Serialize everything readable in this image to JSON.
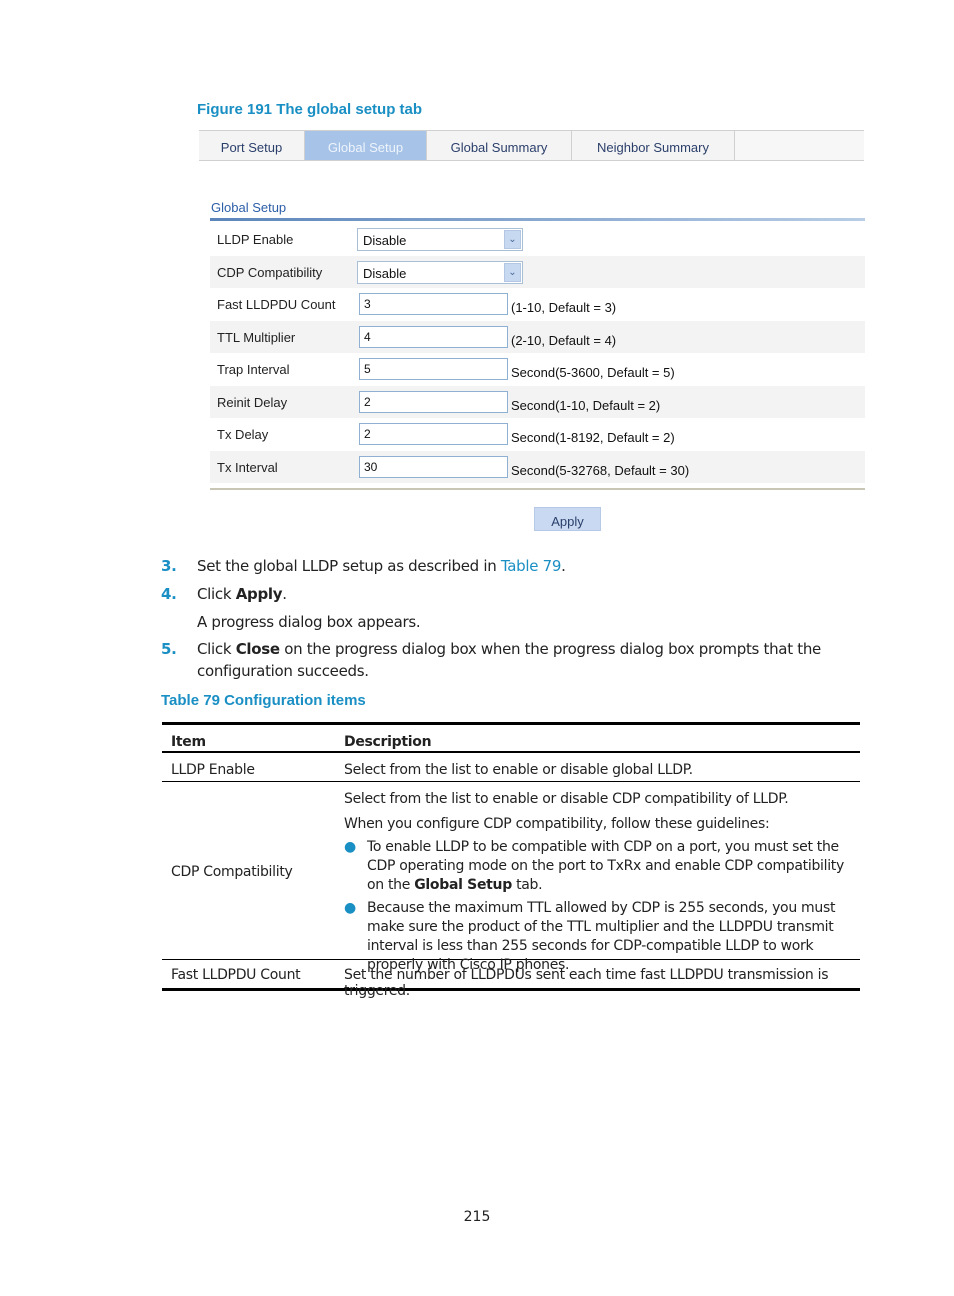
{
  "figure_caption": "Figure 191 The global setup tab",
  "tabs": [
    {
      "label": "Port Setup",
      "active": false
    },
    {
      "label": "Global Setup",
      "active": true
    },
    {
      "label": "Global Summary",
      "active": false
    },
    {
      "label": "Neighbor Summary",
      "active": false
    }
  ],
  "form": {
    "section_title": "Global Setup",
    "lldp_enable": {
      "label": "LLDP Enable",
      "value": "Disable"
    },
    "cdp_compatibility": {
      "label": "CDP Compatibility",
      "value": "Disable"
    },
    "fast_lldpdu_count": {
      "label": "Fast LLDPDU Count",
      "value": "3",
      "hint": "(1-10, Default = 3)"
    },
    "ttl_multiplier": {
      "label": "TTL Multiplier",
      "value": "4",
      "hint": "(2-10, Default = 4)"
    },
    "trap_interval": {
      "label": "Trap Interval",
      "value": "5",
      "hint": "Second(5-3600, Default = 5)"
    },
    "reinit_delay": {
      "label": "Reinit Delay",
      "value": "2",
      "hint": "Second(1-10, Default = 2)"
    },
    "tx_delay": {
      "label": "Tx Delay",
      "value": "2",
      "hint": "Second(1-8192, Default = 2)"
    },
    "tx_interval": {
      "label": "Tx Interval",
      "value": "30",
      "hint": "Second(5-32768, Default = 30)"
    },
    "apply_label": "Apply"
  },
  "steps": {
    "s3": {
      "num": "3.",
      "text_before": "Set the global LLDP setup as described in ",
      "link": "Table 79",
      "text_after": "."
    },
    "s4": {
      "num": "4.",
      "text_before": "Click ",
      "bold": "Apply",
      "text_after": ".",
      "note": "A progress dialog box appears."
    },
    "s5": {
      "num": "5.",
      "text_before": "Click ",
      "bold": "Close",
      "text_after": " on the progress dialog box when the progress dialog box prompts that the",
      "line2": "configuration succeeds."
    }
  },
  "table": {
    "caption": "Table 79 Configuration items",
    "headers": {
      "item": "Item",
      "description": "Description"
    },
    "rows": {
      "r1": {
        "item": "LLDP Enable",
        "desc": "Select from the list to enable or disable global LLDP."
      },
      "r2": {
        "item": "CDP Compatibility",
        "desc1": "Select from the list to enable or disable CDP compatibility of LLDP.",
        "desc2": "When you configure CDP compatibility, follow these guidelines:",
        "b1_text": "To enable LLDP to be compatible with CDP on a port, you must set the CDP operating mode on the port to TxRx and enable CDP compatibility on the ",
        "b1_bold": "Global Setup",
        "b1_after": " tab.",
        "b2_text": "Because the maximum TTL allowed by CDP is 255 seconds, you must make sure the product of the TTL multiplier and the LLDPDU transmit interval is less than 255 seconds for CDP-compatible LLDP to work properly with Cisco IP phones."
      },
      "r3": {
        "item": "Fast LLDPDU Count",
        "desc": "Set the number of LLDPDUs sent each time fast LLDPDU transmission is triggered."
      }
    }
  },
  "page_number": "215"
}
